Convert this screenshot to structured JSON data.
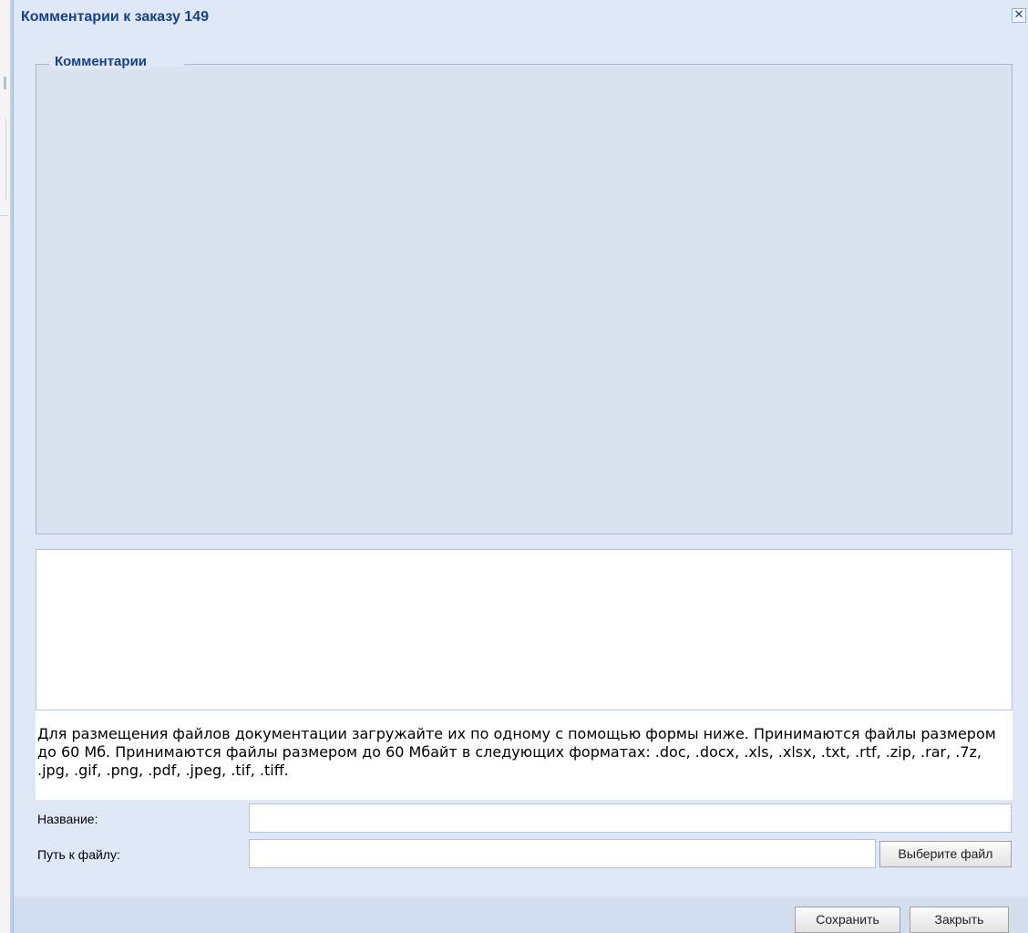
{
  "window": {
    "title": "Комментарии к заказу 149",
    "close_icon": "✕"
  },
  "comments_fieldset": {
    "legend": "Комментарии"
  },
  "comment_input": {
    "value": "",
    "placeholder": ""
  },
  "notice": {
    "text": "Для размещения файлов документации загружайте их по одному с помощью формы ниже. Принимаются файлы размером до 60 Мб. Принимаются файлы размером до 60 Мбайт в следующих форматах: .doc, .docx, .xls, .xlsx, .txt, .rtf, .zip, .rar, .7z, .jpg, .gif, .png, .pdf, .jpeg, .tif, .tiff."
  },
  "form": {
    "name_label": "Название:",
    "name_value": "",
    "path_label": "Путь к файлу:",
    "path_value": "",
    "browse_label": "Выберите файл"
  },
  "footer": {
    "save_label": "Сохранить",
    "close_label": "Закрыть"
  },
  "colors": {
    "title_text": "#15428b",
    "window_bg": "#dfe8f6",
    "fieldset_bg": "#d9e3f0",
    "footer_bg": "#d2deee"
  }
}
